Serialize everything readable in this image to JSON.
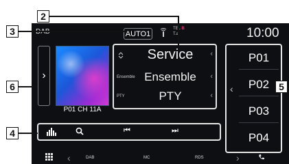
{
  "source": "DAB",
  "auto_button": "AUTO1",
  "status": {
    "tel_label": "TEL",
    "bt_label": "B",
    "signal_label": "T.al"
  },
  "clock": "10:00",
  "album": {
    "channel_label": "P01  CH 11A"
  },
  "info": {
    "rows": [
      {
        "label": "",
        "value": "Service"
      },
      {
        "label": "Ensemble",
        "value": "Ensemble"
      },
      {
        "label": "PTY",
        "value": "PTY"
      }
    ]
  },
  "presets": [
    "P01",
    "P02",
    "P03",
    "P04"
  ],
  "bottom": {
    "left": "DAB",
    "middle": "MC",
    "right": "RDS"
  },
  "callouts": [
    "2",
    "3",
    "6",
    "4",
    "5"
  ],
  "colors": {
    "screen_bg": "#0d0f13",
    "bt_accent": "#ff2d7a",
    "frame": "#e8e8e8"
  },
  "icons": [
    "left-chevron-icon",
    "dab-icon",
    "equalizer-icon",
    "search-icon",
    "previous-track-icon",
    "next-track-icon",
    "grid-menu-icon",
    "phone-icon"
  ]
}
